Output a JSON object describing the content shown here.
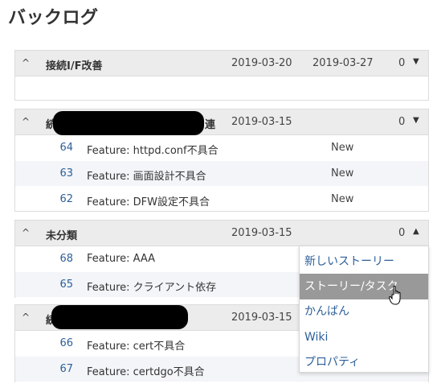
{
  "page": {
    "title": "バックログ"
  },
  "versions": [
    {
      "toggle": "^",
      "name": "接続I/F改善",
      "start_date": "2019-03-20",
      "due_date": "2019-03-27",
      "count": "0",
      "arrow": "▼",
      "items": []
    },
    {
      "toggle": "^",
      "name": "続",
      "name_end": "連",
      "start_date": "2019-03-15",
      "count": "0",
      "arrow": "▼",
      "items": [
        {
          "id": "64",
          "subject": "Feature: httpd.conf不具合",
          "status": "New"
        },
        {
          "id": "63",
          "subject": "Feature: 画面設計不具合",
          "status": "New"
        },
        {
          "id": "62",
          "subject": "Feature: DFW設定不具合",
          "status": "New"
        }
      ]
    },
    {
      "toggle": "^",
      "name": "未分類",
      "start_date": "2019-03-15",
      "count": "0",
      "arrow": "▲",
      "items": [
        {
          "id": "68",
          "subject": "Feature: AAA"
        },
        {
          "id": "65",
          "subject": "Feature: クライアント依存"
        }
      ]
    },
    {
      "toggle": "^",
      "name": "続",
      "start_date": "2019-03-15",
      "items": [
        {
          "id": "66",
          "subject": "Feature: cert不具合"
        },
        {
          "id": "67",
          "subject": "Feature: certdgo不具合"
        }
      ]
    }
  ],
  "dropdown_menu": {
    "items": [
      {
        "label": "新しいストーリー"
      },
      {
        "label": "ストーリー/タスク",
        "highlighted": true
      },
      {
        "label": "かんばん"
      },
      {
        "label": "Wiki"
      },
      {
        "label": "プロパティ"
      }
    ]
  },
  "colors": {
    "link": "#2d5f99",
    "header_bg": "#ececec",
    "row_alt_bg": "#f3f5f8",
    "menu_highlight": "#999999"
  },
  "icons": {
    "cursor": "hand-pointer-icon",
    "toggle": "caret-up-icon"
  }
}
